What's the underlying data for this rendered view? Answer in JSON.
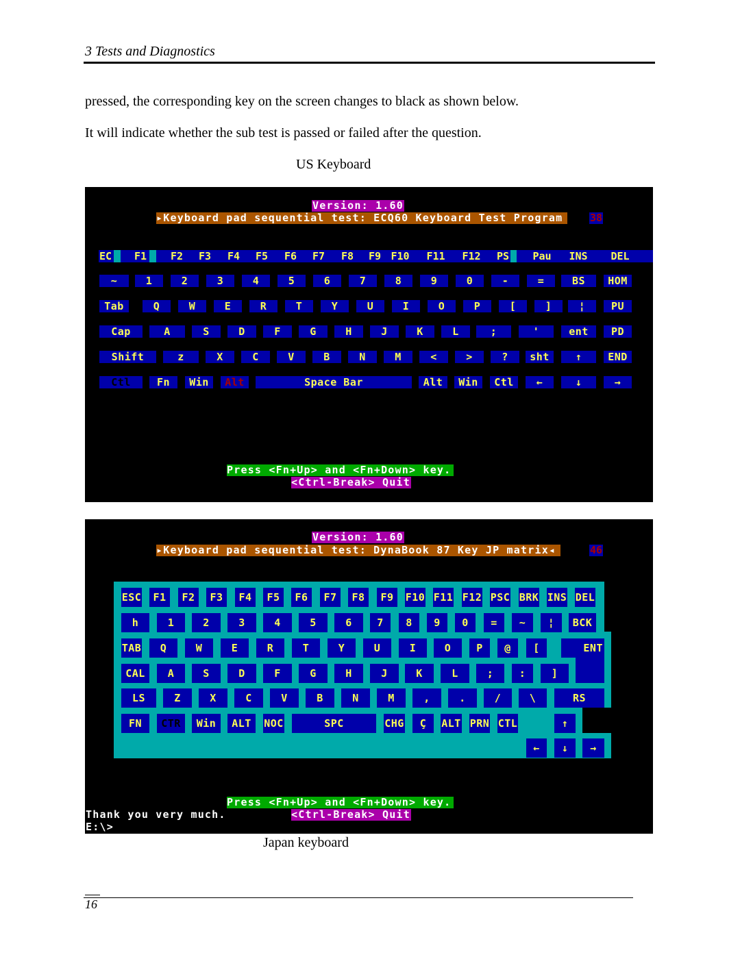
{
  "header": {
    "title": "3 Tests and Diagnostics"
  },
  "body": {
    "line1": "pressed, the corresponding key on the screen changes to black as shown below.",
    "line2": "It will indicate whether the sub test is passed or failed after the question.",
    "caption_us": "US Keyboard",
    "caption_jp": "Japan keyboard"
  },
  "footer": {
    "page_number": "16"
  },
  "colors": {
    "key_bg": "#0000aa",
    "key_text": "#ffff55",
    "board": "#00aaaa",
    "title_bar": "#aa5500",
    "version_bg": "#aa00aa",
    "prompt_bg": "#00aa00",
    "highlight_text": "#aa0000"
  },
  "us_screen": {
    "version": "Version: 1.60",
    "title": "▸Keyboard pad sequential test: ECQ60 Keyboard Test Program",
    "counter": "38",
    "prompt": "Press <Fn+Up> and <Fn+Down> key.",
    "quit": "<Ctrl-Break> Quit",
    "function_row": [
      "EC",
      "F1",
      "F2",
      "F3",
      "F4",
      "F5",
      "F6",
      "F7",
      "F8",
      "F9",
      "F10",
      "F11",
      "F12",
      "PS",
      "Pau",
      "INS",
      "DEL"
    ],
    "rows": [
      [
        {
          "label": "~"
        },
        {
          "label": "1"
        },
        {
          "label": "2"
        },
        {
          "label": "3"
        },
        {
          "label": "4"
        },
        {
          "label": "5"
        },
        {
          "label": "6"
        },
        {
          "label": "7"
        },
        {
          "label": "8"
        },
        {
          "label": "9"
        },
        {
          "label": "0"
        },
        {
          "label": "-"
        },
        {
          "label": "="
        },
        {
          "label": "BS"
        },
        {
          "label": "HOM"
        }
      ],
      [
        {
          "label": "Tab"
        },
        {
          "label": "Q"
        },
        {
          "label": "W"
        },
        {
          "label": "E"
        },
        {
          "label": "R"
        },
        {
          "label": "T"
        },
        {
          "label": "Y"
        },
        {
          "label": "U"
        },
        {
          "label": "I"
        },
        {
          "label": "O"
        },
        {
          "label": "P"
        },
        {
          "label": "["
        },
        {
          "label": "]"
        },
        {
          "label": "¦"
        },
        {
          "label": "PU"
        }
      ],
      [
        {
          "label": "Cap"
        },
        {
          "label": "A"
        },
        {
          "label": "S"
        },
        {
          "label": "D"
        },
        {
          "label": "F"
        },
        {
          "label": "G"
        },
        {
          "label": "H"
        },
        {
          "label": "J"
        },
        {
          "label": "K"
        },
        {
          "label": "L"
        },
        {
          "label": ";"
        },
        {
          "label": "'"
        },
        {
          "label": "ent"
        },
        {
          "label": "PD"
        }
      ],
      [
        {
          "label": "Shift"
        },
        {
          "label": "z"
        },
        {
          "label": "X"
        },
        {
          "label": "C"
        },
        {
          "label": "V"
        },
        {
          "label": "B"
        },
        {
          "label": "N"
        },
        {
          "label": "M"
        },
        {
          "label": "<"
        },
        {
          "label": ">"
        },
        {
          "label": "?"
        },
        {
          "label": "sht"
        },
        {
          "label": "↑"
        },
        {
          "label": "END"
        }
      ],
      [
        {
          "label": "Ctl",
          "state": "pressed"
        },
        {
          "label": "Fn"
        },
        {
          "label": "Win"
        },
        {
          "label": "Alt",
          "state": "highlight"
        },
        {
          "label": "Space Bar"
        },
        {
          "label": "Alt"
        },
        {
          "label": "Win"
        },
        {
          "label": "Ctl"
        },
        {
          "label": "←"
        },
        {
          "label": "↓"
        },
        {
          "label": "→"
        }
      ]
    ]
  },
  "jp_screen": {
    "version": "Version: 1.60",
    "title": "▸Keyboard pad sequential test: DynaBook 87 Key JP matrix◂",
    "counter": "46",
    "prompt": "Press <Fn+Up> and <Fn+Down> key.",
    "quit": "<Ctrl-Break> Quit",
    "message": "Thank you very much.",
    "dos_prompt": "E:\\>",
    "rows": [
      [
        {
          "label": "ESC"
        },
        {
          "label": "F1"
        },
        {
          "label": "F2"
        },
        {
          "label": "F3"
        },
        {
          "label": "F4"
        },
        {
          "label": "F5"
        },
        {
          "label": "F6"
        },
        {
          "label": "F7"
        },
        {
          "label": "F8"
        },
        {
          "label": "F9"
        },
        {
          "label": "F10"
        },
        {
          "label": "F11"
        },
        {
          "label": "F12"
        },
        {
          "label": "PSC"
        },
        {
          "label": "BRK"
        },
        {
          "label": "INS"
        },
        {
          "label": "DEL"
        }
      ],
      [
        {
          "label": "h"
        },
        {
          "label": "1"
        },
        {
          "label": "2"
        },
        {
          "label": "3"
        },
        {
          "label": "4"
        },
        {
          "label": "5"
        },
        {
          "label": "6"
        },
        {
          "label": "7"
        },
        {
          "label": "8"
        },
        {
          "label": "9"
        },
        {
          "label": "0"
        },
        {
          "label": "="
        },
        {
          "label": "~"
        },
        {
          "label": "¦"
        },
        {
          "label": "BCK"
        }
      ],
      [
        {
          "label": "TAB"
        },
        {
          "label": "Q"
        },
        {
          "label": "W"
        },
        {
          "label": "E"
        },
        {
          "label": "R"
        },
        {
          "label": "T"
        },
        {
          "label": "Y"
        },
        {
          "label": "U"
        },
        {
          "label": "I"
        },
        {
          "label": "O"
        },
        {
          "label": "P"
        },
        {
          "label": "@"
        },
        {
          "label": "["
        },
        {
          "label": "ENT"
        }
      ],
      [
        {
          "label": "CAL"
        },
        {
          "label": "A"
        },
        {
          "label": "S"
        },
        {
          "label": "D"
        },
        {
          "label": "F"
        },
        {
          "label": "G"
        },
        {
          "label": "H"
        },
        {
          "label": "J"
        },
        {
          "label": "K"
        },
        {
          "label": "L"
        },
        {
          "label": ";"
        },
        {
          "label": ":"
        },
        {
          "label": "]"
        }
      ],
      [
        {
          "label": "LS"
        },
        {
          "label": "Z"
        },
        {
          "label": "X"
        },
        {
          "label": "C"
        },
        {
          "label": "V"
        },
        {
          "label": "B"
        },
        {
          "label": "N"
        },
        {
          "label": "M"
        },
        {
          "label": ","
        },
        {
          "label": "."
        },
        {
          "label": "/"
        },
        {
          "label": "\\"
        },
        {
          "label": "RS"
        }
      ],
      [
        {
          "label": "FN"
        },
        {
          "label": "CTR",
          "state": "pressed"
        },
        {
          "label": "Win"
        },
        {
          "label": "ALT"
        },
        {
          "label": "NOC"
        },
        {
          "label": "SPC"
        },
        {
          "label": "CHG"
        },
        {
          "label": "Ç"
        },
        {
          "label": "ALT"
        },
        {
          "label": "PRN"
        },
        {
          "label": "CTL"
        },
        {
          "label": "↑"
        }
      ],
      [
        {
          "label": "←"
        },
        {
          "label": "↓"
        },
        {
          "label": "→"
        }
      ]
    ]
  }
}
